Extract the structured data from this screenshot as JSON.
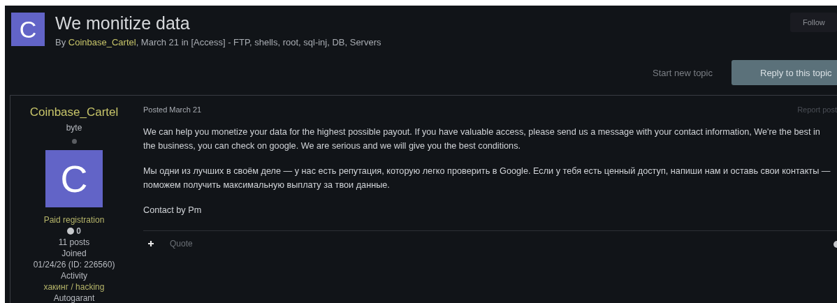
{
  "topic": {
    "avatar_letter": "C",
    "title": "We monitize data",
    "by": "By",
    "author": "Coinbase_Cartel",
    "meta": ", March 21 in [Access] - FTP, shells, root, sql-inj, DB, Servers",
    "follow": "Follow"
  },
  "actions": {
    "start": "Start new topic",
    "reply": "Reply to this topic"
  },
  "post": {
    "author": "Coinbase_Cartel",
    "rank": "byte",
    "avatar_letter": "C",
    "group": "Paid registration",
    "reputation": "0",
    "posts": "11 posts",
    "joined_label": "Joined",
    "joined": "01/24/26 (ID: 226560)",
    "activity_label": "Activity",
    "activity": "хакинг / hacking",
    "extra": "Autogarant",
    "posted": "Posted March 21",
    "report": "Report post",
    "paragraphs": [
      "We can help you monetize your data for the highest possible payout. If you have valuable access, please send us a message with your contact information, We're the best in the business, you can check on google. We are serious and we will give you the best conditions.",
      "Мы одни из лучших в своём деле — у нас есть репутация, которую легко проверить в Google. Если у тебя есть ценный доступ, напиши нам и оставь свои контакты — поможем получить максимальную выплату за твои данные.",
      "Contact by Pm"
    ],
    "quote": "Quote"
  }
}
